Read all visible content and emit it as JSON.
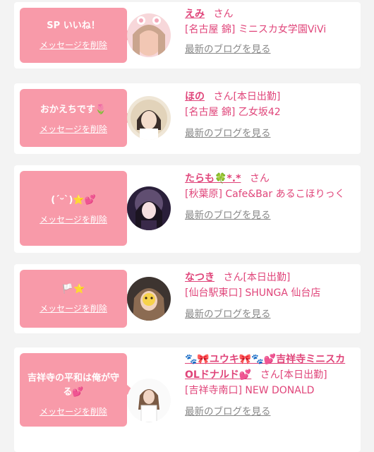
{
  "items": [
    {
      "message": "SP いいね！",
      "delete_label": "メッセージを削除",
      "name": "えみ",
      "san": "さん",
      "status": "",
      "shop": "[名古屋 錦] ミニスカ女学園ViVi",
      "blog_label": "最新のブログを見る",
      "avatar_colors": [
        "#f7d7da",
        "#caa58e"
      ]
    },
    {
      "message": "おかえちです🌷",
      "delete_label": "メッセージを削除",
      "name": "ほの",
      "san": "さん",
      "status": "[本日出勤]",
      "shop": "[名古屋 錦] 乙女坂42",
      "blog_label": "最新のブログを見る",
      "avatar_colors": [
        "#efe6d6",
        "#3a2e2a"
      ]
    },
    {
      "message": "(ˊᵕˋ)⭐💕",
      "delete_label": "メッセージを削除",
      "name": "たらも🍀*.*",
      "san": "さん",
      "status": "",
      "shop": "[秋葉原] Cafe&Bar あるこほりっく",
      "blog_label": "最新のブログを見る",
      "avatar_colors": [
        "#2a1f3a",
        "#c7a6d9"
      ]
    },
    {
      "message": "🏳️⭐",
      "delete_label": "メッセージを削除",
      "name": "なつき",
      "san": "さん",
      "status": "[本日出勤]",
      "shop": "[仙台駅東口] SHUNGA 仙台店",
      "blog_label": "最新のブログを見る",
      "avatar_colors": [
        "#3d3430",
        "#c9a98b"
      ]
    },
    {
      "message": "吉祥寺の平和は俺が守る💕",
      "delete_label": "メッセージを削除",
      "name": "🐾🎀ユウキ🎀🐾💕吉祥寺ミニスカOLドナルド💕",
      "san": "さん",
      "status": "[本日出勤]",
      "shop": "[吉祥寺南口] NEW DONALD",
      "blog_label": "最新のブログを見る",
      "avatar_colors": [
        "#fafafa",
        "#7a5a44"
      ]
    }
  ],
  "colors": {
    "accent": "#e0457a",
    "bubble": "#f89aa9",
    "background": "#f3f3f3"
  }
}
